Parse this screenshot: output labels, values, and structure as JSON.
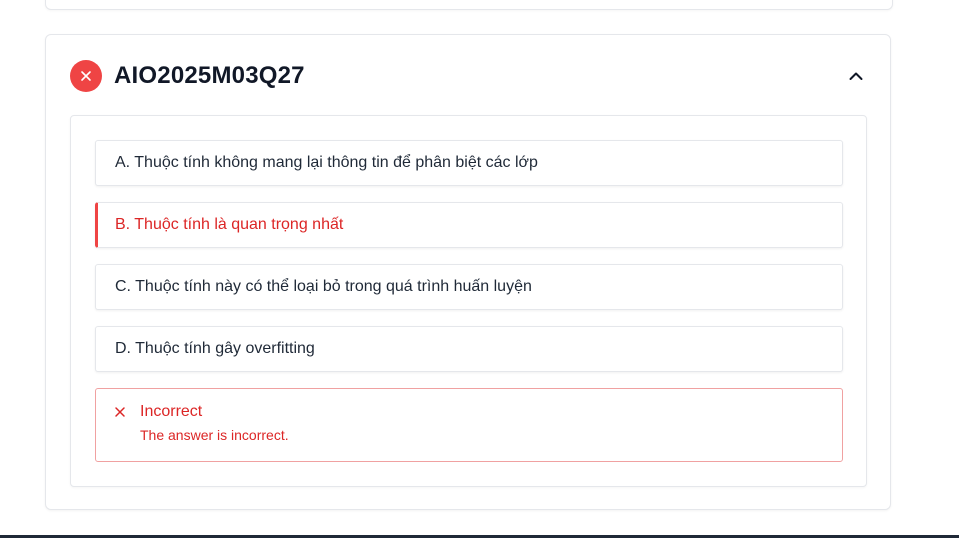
{
  "question": {
    "id": "AIO2025M03Q27",
    "status": "incorrect",
    "status_icon": "close-icon",
    "collapse_icon": "chevron-up-icon",
    "options": [
      {
        "label": "A. Thuộc tính không mang lại thông tin để phân biệt các lớp",
        "selected": false
      },
      {
        "label": "B. Thuộc tính là quan trọng nhất",
        "selected": true
      },
      {
        "label": "C. Thuộc tính này có thể loại bỏ trong quá trình huấn luyện",
        "selected": false
      },
      {
        "label": "D. Thuộc tính gây overfitting",
        "selected": false
      }
    ],
    "feedback": {
      "icon": "close-icon",
      "title": "Incorrect",
      "message": "The answer is incorrect."
    }
  },
  "colors": {
    "error": "#ef4444",
    "error_text": "#dc2626",
    "text": "#1f2937",
    "border": "#e5e7eb"
  }
}
